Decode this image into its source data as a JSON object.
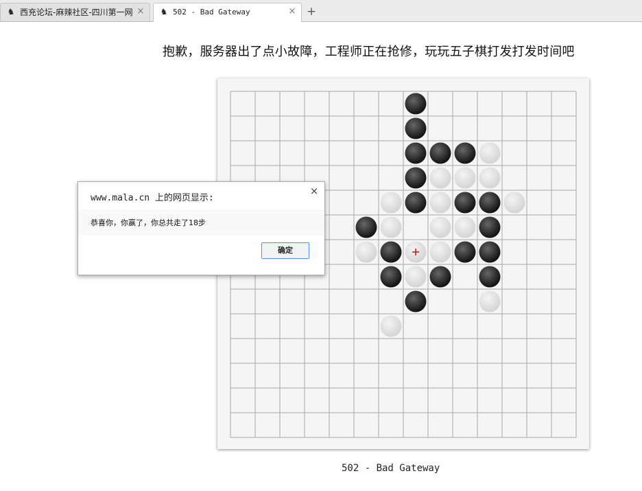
{
  "tabs": [
    {
      "title": "西充论坛-麻辣社区-四川第一网",
      "active": false,
      "favicon": "site-favicon"
    },
    {
      "title": "502 - Bad Gateway",
      "active": true,
      "favicon": "site-favicon"
    }
  ],
  "new_tab_symbol": "+",
  "close_symbol": "×",
  "page": {
    "headline": "抱歉，服务器出了点小故障，工程师正在抢修，玩玩五子棋打发打发时间吧",
    "footer": "502 - Bad Gateway"
  },
  "board": {
    "size": 15,
    "colors": {
      "board_bg": "#f5f5f5",
      "line": "#a8a8a8",
      "black": "#111111",
      "white": "#d4d4d4",
      "marker": "#d01010"
    },
    "last_move_marker": {
      "col": 7,
      "row": 6
    },
    "stones": [
      {
        "col": 7,
        "row": 0,
        "color": "black"
      },
      {
        "col": 7,
        "row": 1,
        "color": "black"
      },
      {
        "col": 7,
        "row": 2,
        "color": "black"
      },
      {
        "col": 8,
        "row": 2,
        "color": "black"
      },
      {
        "col": 9,
        "row": 2,
        "color": "black"
      },
      {
        "col": 10,
        "row": 2,
        "color": "white"
      },
      {
        "col": 7,
        "row": 3,
        "color": "black"
      },
      {
        "col": 8,
        "row": 3,
        "color": "white"
      },
      {
        "col": 9,
        "row": 3,
        "color": "white"
      },
      {
        "col": 10,
        "row": 3,
        "color": "white"
      },
      {
        "col": 6,
        "row": 4,
        "color": "white"
      },
      {
        "col": 7,
        "row": 4,
        "color": "black"
      },
      {
        "col": 8,
        "row": 4,
        "color": "white"
      },
      {
        "col": 9,
        "row": 4,
        "color": "black"
      },
      {
        "col": 10,
        "row": 4,
        "color": "black"
      },
      {
        "col": 11,
        "row": 4,
        "color": "white"
      },
      {
        "col": 5,
        "row": 5,
        "color": "black"
      },
      {
        "col": 6,
        "row": 5,
        "color": "white"
      },
      {
        "col": 8,
        "row": 5,
        "color": "white"
      },
      {
        "col": 9,
        "row": 5,
        "color": "white"
      },
      {
        "col": 10,
        "row": 5,
        "color": "black"
      },
      {
        "col": 5,
        "row": 6,
        "color": "white"
      },
      {
        "col": 6,
        "row": 6,
        "color": "black"
      },
      {
        "col": 7,
        "row": 6,
        "color": "white"
      },
      {
        "col": 8,
        "row": 6,
        "color": "white"
      },
      {
        "col": 9,
        "row": 6,
        "color": "black"
      },
      {
        "col": 10,
        "row": 6,
        "color": "black"
      },
      {
        "col": 6,
        "row": 7,
        "color": "black"
      },
      {
        "col": 7,
        "row": 7,
        "color": "white"
      },
      {
        "col": 8,
        "row": 7,
        "color": "black"
      },
      {
        "col": 10,
        "row": 7,
        "color": "black"
      },
      {
        "col": 7,
        "row": 8,
        "color": "black"
      },
      {
        "col": 10,
        "row": 8,
        "color": "white"
      },
      {
        "col": 6,
        "row": 9,
        "color": "white"
      }
    ]
  },
  "dialog": {
    "title": "www.mala.cn 上的网页显示:",
    "message": "恭喜你，你赢了，你总共走了18步",
    "ok_label": "确定",
    "close_symbol": "×"
  }
}
